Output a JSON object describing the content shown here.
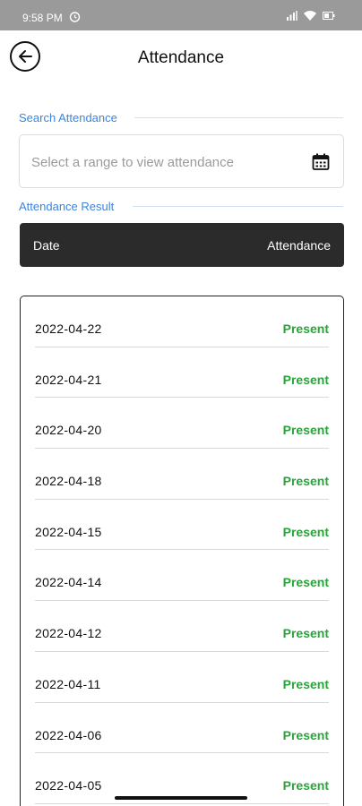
{
  "status_bar": {
    "time": "9:58 PM"
  },
  "header": {
    "title": "Attendance"
  },
  "search_section": {
    "label": "Search Attendance",
    "placeholder": "Select a range to view attendance"
  },
  "result_section": {
    "label": "Attendance Result"
  },
  "table": {
    "col_date": "Date",
    "col_attendance": "Attendance",
    "rows": [
      {
        "date": "2022-04-22",
        "status": "Present"
      },
      {
        "date": "2022-04-21",
        "status": "Present"
      },
      {
        "date": "2022-04-20",
        "status": "Present"
      },
      {
        "date": "2022-04-18",
        "status": "Present"
      },
      {
        "date": "2022-04-15",
        "status": "Present"
      },
      {
        "date": "2022-04-14",
        "status": "Present"
      },
      {
        "date": "2022-04-12",
        "status": "Present"
      },
      {
        "date": "2022-04-11",
        "status": "Present"
      },
      {
        "date": "2022-04-06",
        "status": "Present"
      },
      {
        "date": "2022-04-05",
        "status": "Present"
      }
    ]
  },
  "colors": {
    "accent": "#3d84dc",
    "present": "#2aa43a",
    "header_bg": "#2b2b2b"
  },
  "icons": {
    "back": "arrow-left-icon",
    "calendar": "calendar-icon"
  }
}
